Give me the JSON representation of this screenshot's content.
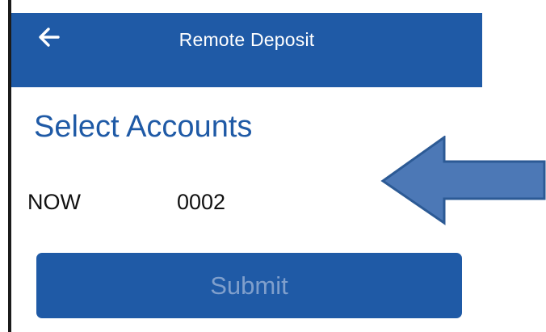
{
  "header": {
    "title": "Remote Deposit",
    "back_icon": "arrow-left-icon"
  },
  "section": {
    "title": "Select Accounts"
  },
  "accounts": [
    {
      "type": "NOW",
      "number": "0002"
    }
  ],
  "actions": {
    "submit_label": "Submit"
  },
  "annotation": {
    "pointer_icon": "left-arrow-callout-icon"
  },
  "colors": {
    "header_bg": "#1f5aa6",
    "accent": "#1f5aa6",
    "arrow_fill": "#4c78b6",
    "arrow_stroke": "#2c5a95"
  }
}
